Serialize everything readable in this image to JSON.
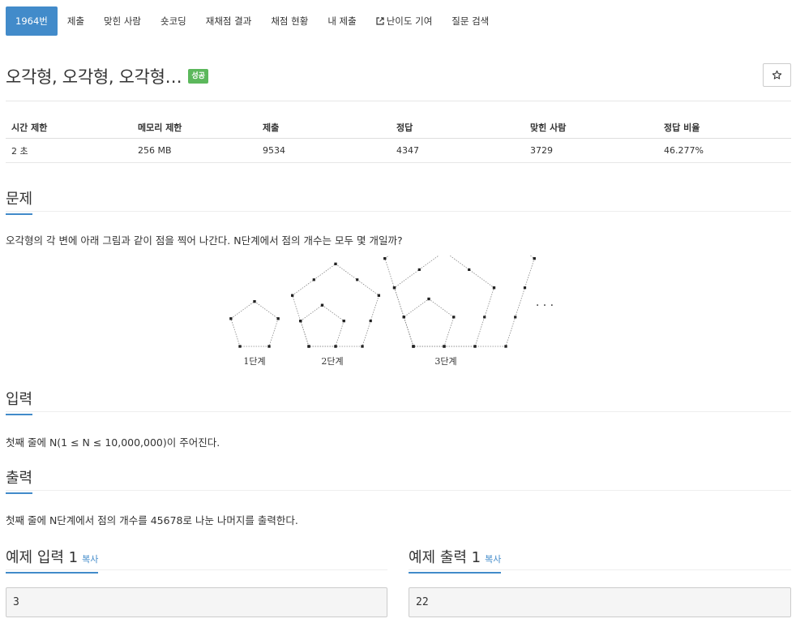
{
  "tabs": [
    {
      "label": "1964번",
      "active": true
    },
    {
      "label": "제출"
    },
    {
      "label": "맞힌 사람"
    },
    {
      "label": "숏코딩"
    },
    {
      "label": "재채점 결과"
    },
    {
      "label": "채점 현황"
    },
    {
      "label": "내 제출"
    },
    {
      "label": "난이도 기여",
      "icon": "external-link-icon"
    },
    {
      "label": "질문 검색"
    }
  ],
  "problem": {
    "title": "오각형, 오각형, 오각형…",
    "badge": "성공",
    "star_icon": "star-icon"
  },
  "info_table": {
    "headers": [
      "시간 제한",
      "메모리 제한",
      "제출",
      "정답",
      "맞힌 사람",
      "정답 비율"
    ],
    "values": [
      "2 초",
      "256 MB",
      "9534",
      "4347",
      "3729",
      "46.277%"
    ]
  },
  "sections": {
    "problem": {
      "heading": "문제",
      "text": "오각형의 각 변에 아래 그림과 같이 점을 찍어 나간다. N단계에서 점의 개수는 모두 몇 개일까?"
    },
    "figure": {
      "labels": [
        "1단계",
        "2단계",
        "3단계"
      ],
      "ellipsis": "· · ·"
    },
    "input": {
      "heading": "입력",
      "text": "첫째 줄에 N(1 ≤ N ≤ 10,000,000)이 주어진다."
    },
    "output": {
      "heading": "출력",
      "text": "첫째 줄에 N단계에서 점의 개수를 45678로 나눈 나머지를 출력한다."
    }
  },
  "samples": {
    "input_heading": "예제 입력 1",
    "output_heading": "예제 출력 1",
    "copy_label": "복사",
    "input_value": "3",
    "output_value": "22"
  },
  "colors": {
    "accent": "#428bca",
    "success": "#5cb85c"
  }
}
